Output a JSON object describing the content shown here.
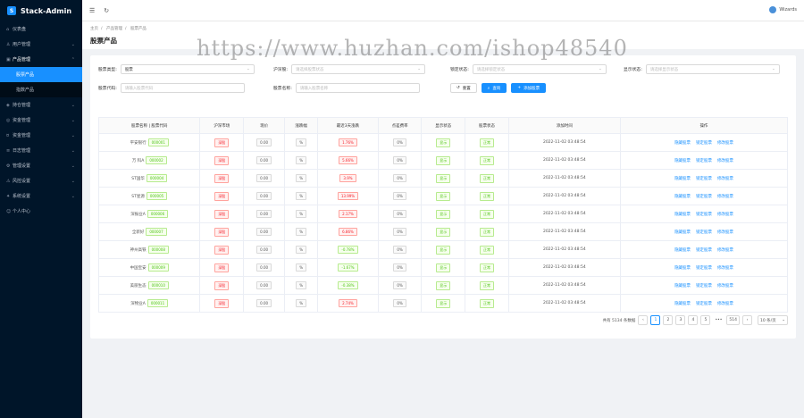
{
  "app": {
    "title": "Stack-Admin",
    "logo_char": "S"
  },
  "sidebar": {
    "items": [
      {
        "label": "仪表盘",
        "icon": "dashboard-icon",
        "has_arrow": false
      },
      {
        "label": "用户管理",
        "icon": "user-icon",
        "has_arrow": true
      },
      {
        "label": "产品管理",
        "icon": "product-icon",
        "has_arrow": true,
        "open": true,
        "children": [
          {
            "label": "股票产品",
            "active": true
          },
          {
            "label": "指数产品",
            "active": false
          }
        ]
      },
      {
        "label": "持仓管理",
        "icon": "position-icon",
        "has_arrow": true
      },
      {
        "label": "资金管理",
        "icon": "fund-icon",
        "has_arrow": true
      },
      {
        "label": "资金管理",
        "icon": "money-icon",
        "has_arrow": true
      },
      {
        "label": "日志管理",
        "icon": "log-icon",
        "has_arrow": true
      },
      {
        "label": "管理设置",
        "icon": "admin-icon",
        "has_arrow": true
      },
      {
        "label": "风控设置",
        "icon": "risk-icon",
        "has_arrow": true
      },
      {
        "label": "系统设置",
        "icon": "system-icon",
        "has_arrow": true
      },
      {
        "label": "个人中心",
        "icon": "person-icon",
        "has_arrow": false
      }
    ]
  },
  "topbar": {
    "user": "Wizards"
  },
  "breadcrumb": [
    "主页",
    "产品管理",
    "股票产品"
  ],
  "page_title": "股票产品",
  "filters": {
    "stock_type_label": "股票类型:",
    "stock_type_value": "股票",
    "shsz_label": "沪深股:",
    "shsz_placeholder": "请选择股票状态",
    "lock_label": "锁定状态:",
    "lock_placeholder": "请选择锁定状态",
    "show_label": "显示状态:",
    "show_placeholder": "请选择显示状态",
    "code_label": "股票代码:",
    "code_placeholder": "请输入股票代码",
    "name_label": "股票名称:",
    "name_placeholder": "请输入股票名称",
    "reset_label": "重置",
    "search_label": "查询",
    "add_label": "添加股票"
  },
  "table": {
    "headers": [
      "股票名称 | 股票代码",
      "沪深市场",
      "现价",
      "涨跌幅",
      "最近3天涨跌",
      "点差费率",
      "显示状态",
      "股票状态",
      "添加时间",
      "操作"
    ],
    "rows": [
      {
        "name": "平安银行",
        "code": "000001",
        "market": "深股",
        "price": "0.00",
        "chg": "%",
        "d3": "1.76%",
        "d3_dir": "up",
        "fee": "0%",
        "show": "显示",
        "status": "正常",
        "time": "2022-11-02 03:48:54"
      },
      {
        "name": "万 科A",
        "code": "000002",
        "market": "深股",
        "price": "0.00",
        "chg": "%",
        "d3": "5.66%",
        "d3_dir": "up",
        "fee": "0%",
        "show": "显示",
        "status": "正常",
        "time": "2022-11-02 03:48:54"
      },
      {
        "name": "ST国华",
        "code": "000004",
        "market": "深股",
        "price": "0.00",
        "chg": "%",
        "d3": "3.9%",
        "d3_dir": "up",
        "fee": "0%",
        "show": "显示",
        "status": "正常",
        "time": "2022-11-02 03:48:54"
      },
      {
        "name": "ST星源",
        "code": "000005",
        "market": "深股",
        "price": "0.00",
        "chg": "%",
        "d3": "13.99%",
        "d3_dir": "up",
        "fee": "0%",
        "show": "显示",
        "status": "正常",
        "time": "2022-11-02 03:48:54"
      },
      {
        "name": "深振业A",
        "code": "000006",
        "market": "深股",
        "price": "0.00",
        "chg": "%",
        "d3": "2.17%",
        "d3_dir": "up",
        "fee": "0%",
        "show": "显示",
        "status": "正常",
        "time": "2022-11-02 03:48:54"
      },
      {
        "name": "全新好",
        "code": "000007",
        "market": "深股",
        "price": "0.00",
        "chg": "%",
        "d3": "6.86%",
        "d3_dir": "up",
        "fee": "0%",
        "show": "显示",
        "status": "正常",
        "time": "2022-11-02 03:48:54"
      },
      {
        "name": "神州高铁",
        "code": "000008",
        "market": "深股",
        "price": "0.00",
        "chg": "%",
        "d3": "-0.78%",
        "d3_dir": "down",
        "fee": "0%",
        "show": "显示",
        "status": "正常",
        "time": "2022-11-02 03:48:54"
      },
      {
        "name": "中国宝安",
        "code": "000009",
        "market": "深股",
        "price": "0.00",
        "chg": "%",
        "d3": "-1.67%",
        "d3_dir": "down",
        "fee": "0%",
        "show": "显示",
        "status": "正常",
        "time": "2022-11-02 03:48:54"
      },
      {
        "name": "美丽生态",
        "code": "000010",
        "market": "深股",
        "price": "0.00",
        "chg": "%",
        "d3": "-0.38%",
        "d3_dir": "down",
        "fee": "0%",
        "show": "显示",
        "status": "正常",
        "time": "2022-11-02 03:48:54"
      },
      {
        "name": "深物业A",
        "code": "000011",
        "market": "深股",
        "price": "0.00",
        "chg": "%",
        "d3": "2.74%",
        "d3_dir": "up",
        "fee": "0%",
        "show": "显示",
        "status": "正常",
        "time": "2022-11-02 03:48:54"
      }
    ],
    "ops": [
      "隐藏股票",
      "锁定股票",
      "修改股票"
    ]
  },
  "pagination": {
    "total_text": "共有 5134 条数据",
    "pages": [
      "1",
      "2",
      "3",
      "4",
      "5",
      "•••",
      "514"
    ],
    "page_size": "10 条/页"
  },
  "watermark": "https://www.huzhan.com/ishop48540",
  "colors": {
    "sidebar": "#001529",
    "primary": "#1890ff",
    "up": "#f5222d",
    "down": "#52c41a"
  }
}
